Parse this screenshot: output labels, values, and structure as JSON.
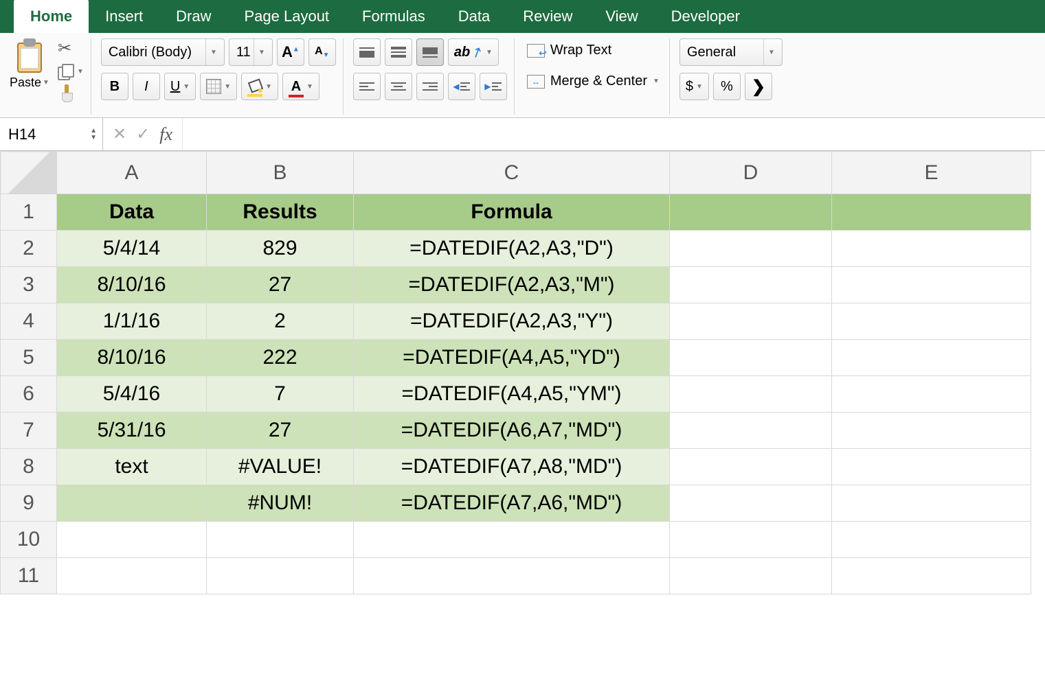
{
  "tabs": [
    "Home",
    "Insert",
    "Draw",
    "Page Layout",
    "Formulas",
    "Data",
    "Review",
    "View",
    "Developer"
  ],
  "activeTab": 0,
  "ribbon": {
    "paste_label": "Paste",
    "font_name": "Calibri (Body)",
    "font_size": "11",
    "increase_font_glyph": "A",
    "decrease_font_glyph": "A",
    "bold": "B",
    "italic": "I",
    "underline": "U",
    "wrap_text": "Wrap Text",
    "merge_center": "Merge & Center",
    "number_format": "General",
    "currency": "$",
    "percent": "%"
  },
  "formulaBar": {
    "name_box": "H14",
    "fx": "fx",
    "value": ""
  },
  "columns": [
    "A",
    "B",
    "C",
    "D",
    "E"
  ],
  "rowNums": [
    "1",
    "2",
    "3",
    "4",
    "5",
    "6",
    "7",
    "8",
    "9",
    "10",
    "11"
  ],
  "header": {
    "A": "Data",
    "B": "Results",
    "C": "Formula"
  },
  "rows": [
    {
      "A": "5/4/14",
      "B": "829",
      "C": "=DATEDIF(A2,A3,\"D\")",
      "band": "light"
    },
    {
      "A": "8/10/16",
      "B": "27",
      "C": "=DATEDIF(A2,A3,\"M\")",
      "band": "dark"
    },
    {
      "A": "1/1/16",
      "B": "2",
      "C": "=DATEDIF(A2,A3,\"Y\")",
      "band": "light"
    },
    {
      "A": "8/10/16",
      "B": "222",
      "C": "=DATEDIF(A4,A5,\"YD\")",
      "band": "dark"
    },
    {
      "A": "5/4/16",
      "B": "7",
      "C": "=DATEDIF(A4,A5,\"YM\")",
      "band": "light"
    },
    {
      "A": "5/31/16",
      "B": "27",
      "C": "=DATEDIF(A6,A7,\"MD\")",
      "band": "dark"
    },
    {
      "A": "text",
      "B": "#VALUE!",
      "C": "=DATEDIF(A7,A8,\"MD\")",
      "band": "light"
    },
    {
      "A": "",
      "B": "#NUM!",
      "C": "=DATEDIF(A7,A6,\"MD\")",
      "band": "dark"
    }
  ]
}
